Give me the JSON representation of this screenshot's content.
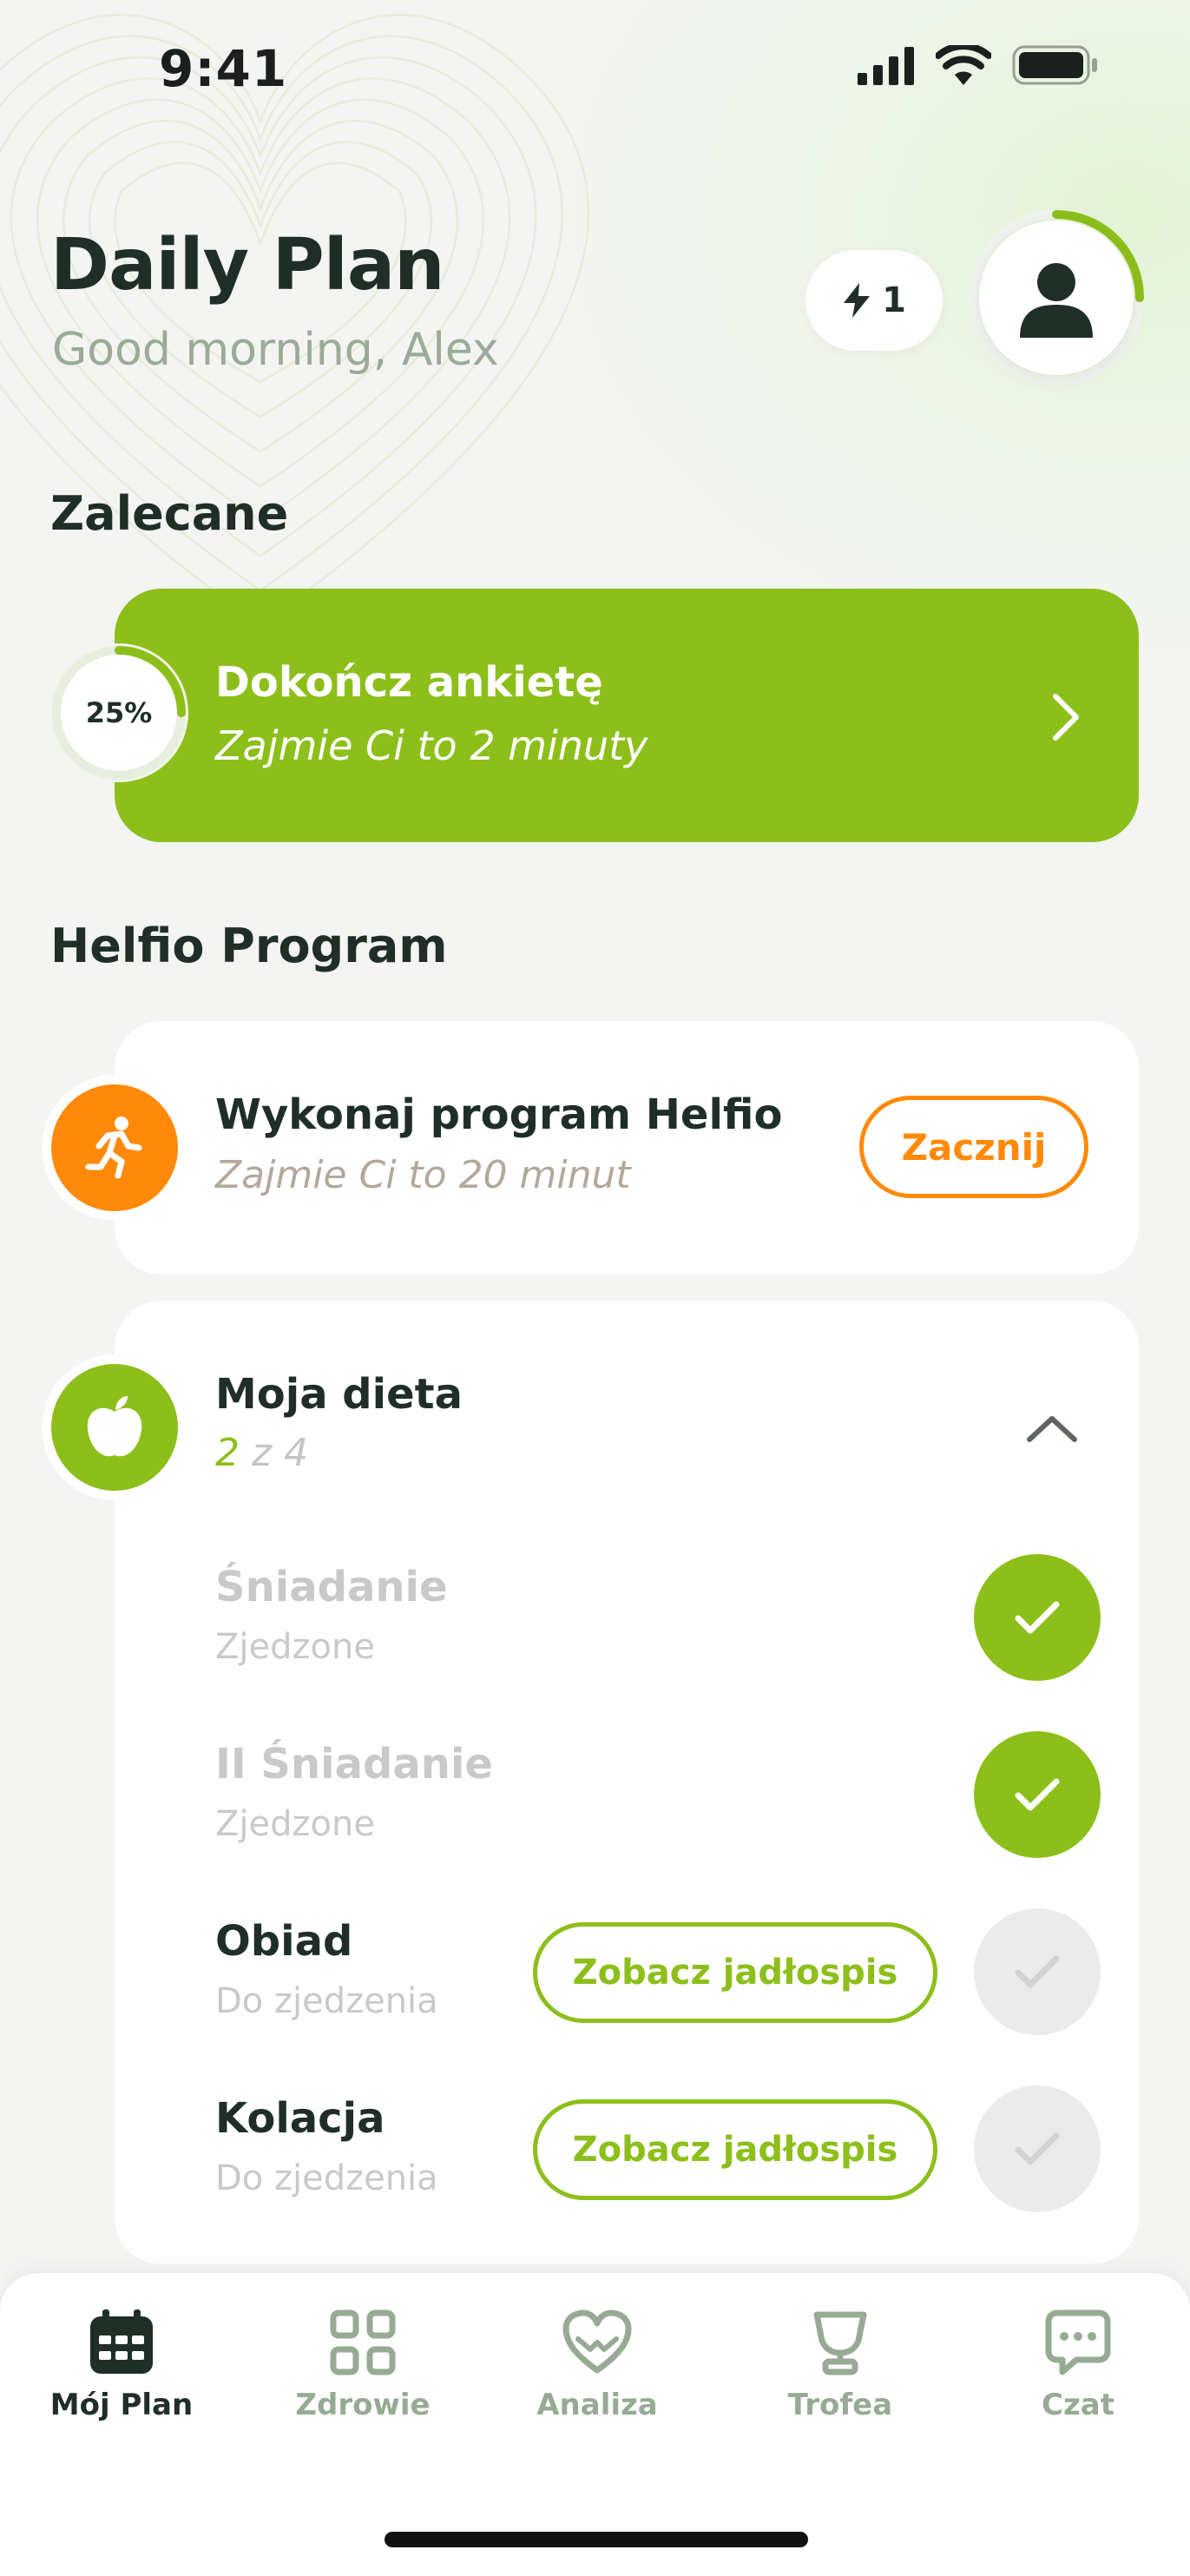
{
  "status_bar": {
    "time": "9:41"
  },
  "header": {
    "title": "Daily Plan",
    "greeting": "Good morning, Alex",
    "streak_count": "1",
    "avatar_progress": 0.25
  },
  "recommended": {
    "section_title": "Zalecane",
    "card": {
      "progress_label": "25%",
      "progress_value": 0.25,
      "title": "Dokończ ankietę",
      "subtitle": "Zajmie Ci to 2 minuty"
    }
  },
  "program": {
    "section_title": "Helfio Program",
    "task": {
      "title": "Wykonaj program Helfio",
      "subtitle": "Zajmie Ci to 20 minut",
      "button_label": "Zacznij",
      "icon": "running-icon"
    }
  },
  "diet": {
    "title": "Moja dieta",
    "done_count": "2",
    "progress_rest": " z 4",
    "icon": "apple-icon",
    "meals": [
      {
        "name": "Śniadanie",
        "status": "Zjedzone",
        "done": true
      },
      {
        "name": "II Śniadanie",
        "status": "Zjedzone",
        "done": true
      },
      {
        "name": "Obiad",
        "status": "Do zjedzenia",
        "done": false,
        "button_label": "Zobacz jadłospis"
      },
      {
        "name": "Kolacja",
        "status": "Do zjedzenia",
        "done": false,
        "button_label": "Zobacz jadłospis"
      }
    ]
  },
  "tabbar": {
    "tabs": [
      {
        "label": "Mój Plan",
        "icon": "calendar-icon",
        "active": true
      },
      {
        "label": "Zdrowie",
        "icon": "grid-icon",
        "active": false
      },
      {
        "label": "Analiza",
        "icon": "heart-icon",
        "active": false
      },
      {
        "label": "Trofea",
        "icon": "trophy-icon",
        "active": false
      },
      {
        "label": "Czat",
        "icon": "chat-icon",
        "active": false
      }
    ]
  },
  "colors": {
    "accent_green": "#8cbf1a",
    "accent_orange": "#ff8a0a",
    "text_dark": "#1f2f27",
    "text_muted": "#9aab98"
  }
}
